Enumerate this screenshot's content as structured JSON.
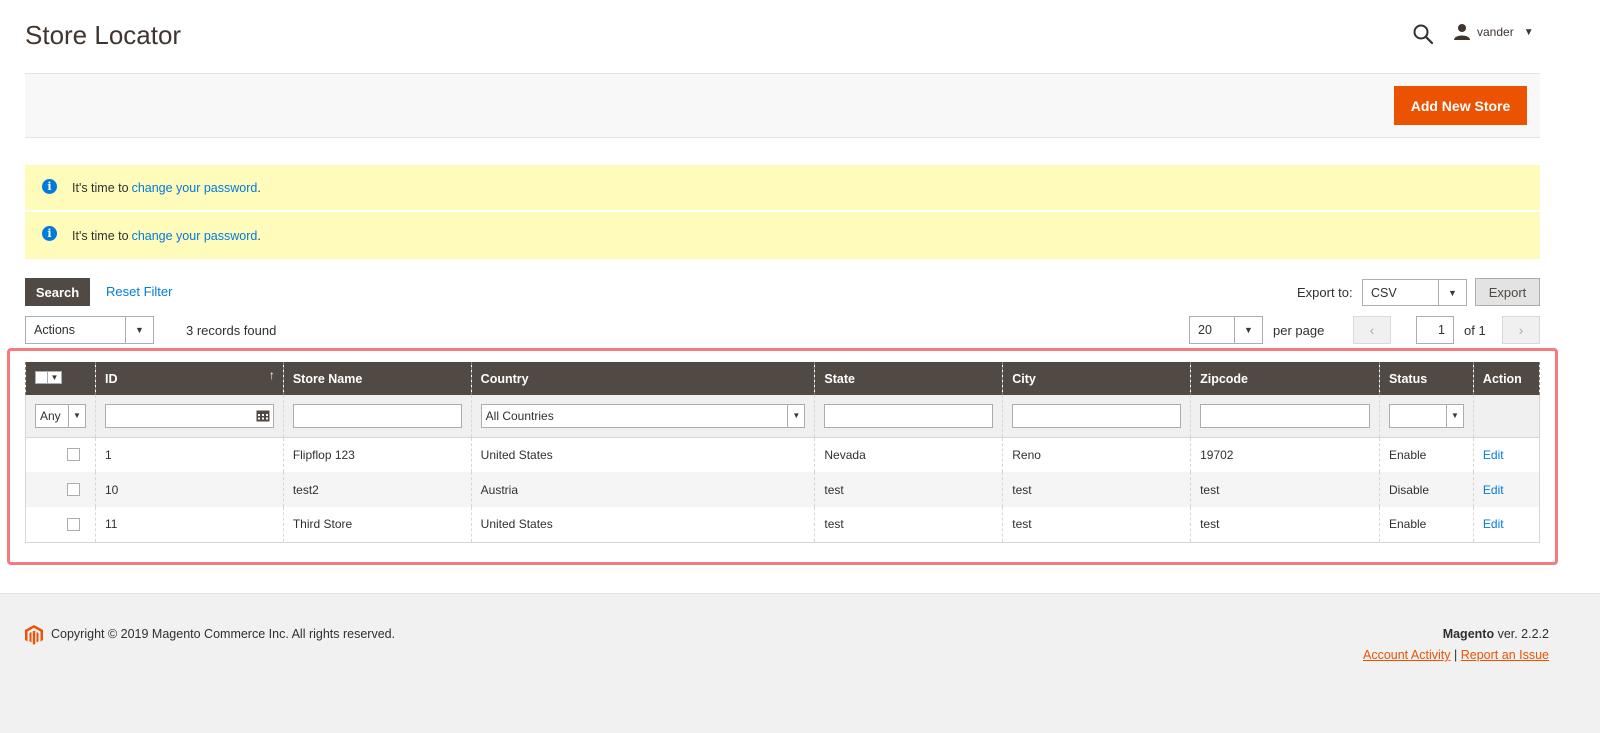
{
  "header": {
    "title": "Store Locator",
    "user_name": "vander"
  },
  "actions": {
    "add_new_store": "Add New Store"
  },
  "messages": [
    {
      "prefix": "It's time to",
      "link": "change your password",
      "suffix": "."
    },
    {
      "prefix": "It's time to",
      "link": "change your password",
      "suffix": "."
    }
  ],
  "toolbar": {
    "search": "Search",
    "reset_filter": "Reset Filter",
    "export_label": "Export to:",
    "export_format": "CSV",
    "export_button": "Export",
    "mass_actions": "Actions",
    "records_found": "3 records found",
    "per_page_value": "20",
    "per_page_label": "per page",
    "current_page": "1",
    "page_total": "of 1"
  },
  "grid": {
    "columns": [
      "ID",
      "Store Name",
      "Country",
      "State",
      "City",
      "Zipcode",
      "Status",
      "Action"
    ],
    "filters": {
      "mass_select": "Any",
      "country": "All Countries"
    },
    "rows": [
      {
        "id": "1",
        "name": "Flipflop 123",
        "country": "United States",
        "state": "Nevada",
        "city": "Reno",
        "zipcode": "19702",
        "status": "Enable",
        "action": "Edit"
      },
      {
        "id": "10",
        "name": "test2",
        "country": "Austria",
        "state": "test",
        "city": "test",
        "zipcode": "test",
        "status": "Disable",
        "action": "Edit"
      },
      {
        "id": "11",
        "name": "Third Store",
        "country": "United States",
        "state": "test",
        "city": "test",
        "zipcode": "test",
        "status": "Enable",
        "action": "Edit"
      }
    ]
  },
  "footer": {
    "copyright": "Copyright © 2019 Magento Commerce Inc. All rights reserved.",
    "brand": "Magento",
    "version": "ver. 2.2.2",
    "account_activity": "Account Activity",
    "separator": "|",
    "report_issue": "Report an Issue"
  },
  "colors": {
    "accent": "#eb5202",
    "header_dark": "#514943",
    "link": "#007bdb",
    "message_bg": "#fffbbb",
    "highlight": "#f47b7e"
  }
}
